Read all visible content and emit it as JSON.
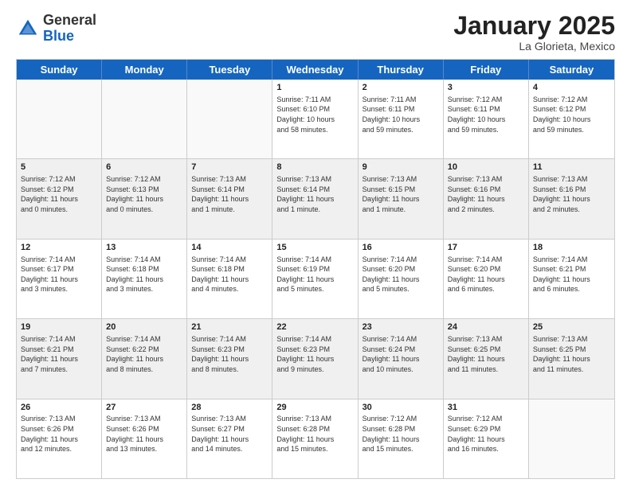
{
  "header": {
    "logo_general": "General",
    "logo_blue": "Blue",
    "month_title": "January 2025",
    "subtitle": "La Glorieta, Mexico"
  },
  "weekdays": [
    "Sunday",
    "Monday",
    "Tuesday",
    "Wednesday",
    "Thursday",
    "Friday",
    "Saturday"
  ],
  "rows": [
    [
      {
        "day": "",
        "info": "",
        "empty": true
      },
      {
        "day": "",
        "info": "",
        "empty": true
      },
      {
        "day": "",
        "info": "",
        "empty": true
      },
      {
        "day": "1",
        "info": "Sunrise: 7:11 AM\nSunset: 6:10 PM\nDaylight: 10 hours\nand 58 minutes."
      },
      {
        "day": "2",
        "info": "Sunrise: 7:11 AM\nSunset: 6:11 PM\nDaylight: 10 hours\nand 59 minutes."
      },
      {
        "day": "3",
        "info": "Sunrise: 7:12 AM\nSunset: 6:11 PM\nDaylight: 10 hours\nand 59 minutes."
      },
      {
        "day": "4",
        "info": "Sunrise: 7:12 AM\nSunset: 6:12 PM\nDaylight: 10 hours\nand 59 minutes."
      }
    ],
    [
      {
        "day": "5",
        "info": "Sunrise: 7:12 AM\nSunset: 6:12 PM\nDaylight: 11 hours\nand 0 minutes.",
        "shaded": true
      },
      {
        "day": "6",
        "info": "Sunrise: 7:12 AM\nSunset: 6:13 PM\nDaylight: 11 hours\nand 0 minutes.",
        "shaded": true
      },
      {
        "day": "7",
        "info": "Sunrise: 7:13 AM\nSunset: 6:14 PM\nDaylight: 11 hours\nand 1 minute.",
        "shaded": true
      },
      {
        "day": "8",
        "info": "Sunrise: 7:13 AM\nSunset: 6:14 PM\nDaylight: 11 hours\nand 1 minute.",
        "shaded": true
      },
      {
        "day": "9",
        "info": "Sunrise: 7:13 AM\nSunset: 6:15 PM\nDaylight: 11 hours\nand 1 minute.",
        "shaded": true
      },
      {
        "day": "10",
        "info": "Sunrise: 7:13 AM\nSunset: 6:16 PM\nDaylight: 11 hours\nand 2 minutes.",
        "shaded": true
      },
      {
        "day": "11",
        "info": "Sunrise: 7:13 AM\nSunset: 6:16 PM\nDaylight: 11 hours\nand 2 minutes.",
        "shaded": true
      }
    ],
    [
      {
        "day": "12",
        "info": "Sunrise: 7:14 AM\nSunset: 6:17 PM\nDaylight: 11 hours\nand 3 minutes."
      },
      {
        "day": "13",
        "info": "Sunrise: 7:14 AM\nSunset: 6:18 PM\nDaylight: 11 hours\nand 3 minutes."
      },
      {
        "day": "14",
        "info": "Sunrise: 7:14 AM\nSunset: 6:18 PM\nDaylight: 11 hours\nand 4 minutes."
      },
      {
        "day": "15",
        "info": "Sunrise: 7:14 AM\nSunset: 6:19 PM\nDaylight: 11 hours\nand 5 minutes."
      },
      {
        "day": "16",
        "info": "Sunrise: 7:14 AM\nSunset: 6:20 PM\nDaylight: 11 hours\nand 5 minutes."
      },
      {
        "day": "17",
        "info": "Sunrise: 7:14 AM\nSunset: 6:20 PM\nDaylight: 11 hours\nand 6 minutes."
      },
      {
        "day": "18",
        "info": "Sunrise: 7:14 AM\nSunset: 6:21 PM\nDaylight: 11 hours\nand 6 minutes."
      }
    ],
    [
      {
        "day": "19",
        "info": "Sunrise: 7:14 AM\nSunset: 6:21 PM\nDaylight: 11 hours\nand 7 minutes.",
        "shaded": true
      },
      {
        "day": "20",
        "info": "Sunrise: 7:14 AM\nSunset: 6:22 PM\nDaylight: 11 hours\nand 8 minutes.",
        "shaded": true
      },
      {
        "day": "21",
        "info": "Sunrise: 7:14 AM\nSunset: 6:23 PM\nDaylight: 11 hours\nand 8 minutes.",
        "shaded": true
      },
      {
        "day": "22",
        "info": "Sunrise: 7:14 AM\nSunset: 6:23 PM\nDaylight: 11 hours\nand 9 minutes.",
        "shaded": true
      },
      {
        "day": "23",
        "info": "Sunrise: 7:14 AM\nSunset: 6:24 PM\nDaylight: 11 hours\nand 10 minutes.",
        "shaded": true
      },
      {
        "day": "24",
        "info": "Sunrise: 7:13 AM\nSunset: 6:25 PM\nDaylight: 11 hours\nand 11 minutes.",
        "shaded": true
      },
      {
        "day": "25",
        "info": "Sunrise: 7:13 AM\nSunset: 6:25 PM\nDaylight: 11 hours\nand 11 minutes.",
        "shaded": true
      }
    ],
    [
      {
        "day": "26",
        "info": "Sunrise: 7:13 AM\nSunset: 6:26 PM\nDaylight: 11 hours\nand 12 minutes."
      },
      {
        "day": "27",
        "info": "Sunrise: 7:13 AM\nSunset: 6:26 PM\nDaylight: 11 hours\nand 13 minutes."
      },
      {
        "day": "28",
        "info": "Sunrise: 7:13 AM\nSunset: 6:27 PM\nDaylight: 11 hours\nand 14 minutes."
      },
      {
        "day": "29",
        "info": "Sunrise: 7:13 AM\nSunset: 6:28 PM\nDaylight: 11 hours\nand 15 minutes."
      },
      {
        "day": "30",
        "info": "Sunrise: 7:12 AM\nSunset: 6:28 PM\nDaylight: 11 hours\nand 15 minutes."
      },
      {
        "day": "31",
        "info": "Sunrise: 7:12 AM\nSunset: 6:29 PM\nDaylight: 11 hours\nand 16 minutes."
      },
      {
        "day": "",
        "info": "",
        "empty": true
      }
    ]
  ]
}
